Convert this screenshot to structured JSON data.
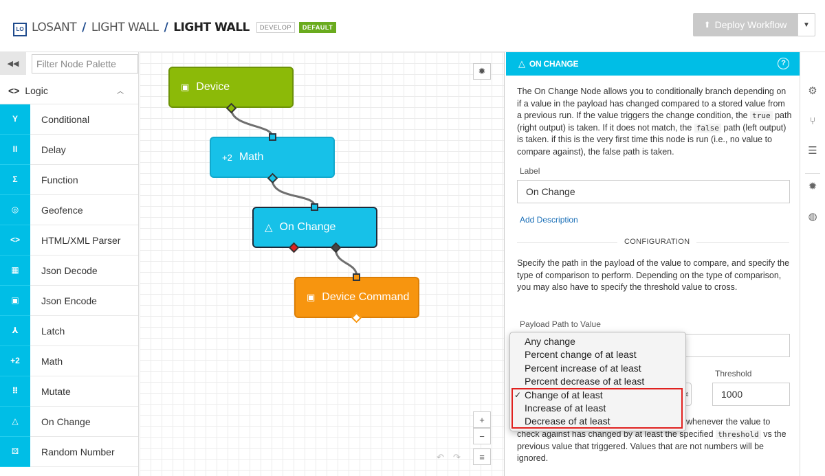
{
  "header": {
    "logo_text": "LO",
    "crumbs": [
      "LOSANT",
      "LIGHT WALL",
      "LIGHT WALL"
    ],
    "separator": "/",
    "tag_develop": "DEVELOP",
    "tag_default": "DEFAULT",
    "deploy_label": "Deploy Workflow"
  },
  "palette": {
    "filter_placeholder": "Filter Node Palette",
    "category": "Logic",
    "items": [
      {
        "icon": "Y",
        "label": "Conditional"
      },
      {
        "icon": "II",
        "label": "Delay"
      },
      {
        "icon": "Σ",
        "label": "Function"
      },
      {
        "icon": "◎",
        "label": "Geofence"
      },
      {
        "icon": "<>",
        "label": "HTML/XML Parser"
      },
      {
        "icon": "▦",
        "label": "Json Decode"
      },
      {
        "icon": "▣",
        "label": "Json Encode"
      },
      {
        "icon": "⅄",
        "label": "Latch"
      },
      {
        "icon": "+2",
        "label": "Math"
      },
      {
        "icon": "⠿",
        "label": "Mutate"
      },
      {
        "icon": "△",
        "label": "On Change"
      },
      {
        "icon": "⚄",
        "label": "Random Number"
      }
    ]
  },
  "canvas": {
    "nodes": {
      "device": {
        "icon": "▣",
        "label": "Device"
      },
      "math": {
        "icon": "+2",
        "label": "Math"
      },
      "onchange": {
        "icon": "△",
        "label": "On Change"
      },
      "devcmd": {
        "icon": "▣",
        "label": "Device Command"
      }
    },
    "zoom_in": "+",
    "zoom_out": "−",
    "menu": "≡"
  },
  "panel": {
    "title": "ON CHANGE",
    "help": "?",
    "desc_1": "The On Change Node allows you to conditionally branch depending on if a value in the payload has changed compared to a stored value from a previous run. If the value triggers the change condition, the",
    "code_true": "true",
    "desc_2": "path (right output) is taken. If it does not match, the",
    "code_false": "false",
    "desc_3": "path (left output) is taken. if this is the very first time this node is run (i.e., no value to compare against), the false path is taken.",
    "label_label": "Label",
    "label_value": "On Change",
    "add_description": "Add Description",
    "config_title": "CONFIGURATION",
    "config_desc": "Specify the path in the payload of the value to compare, and specify the type of comparison to perform. Depending on the type of comparison, you may also have to specify the threshold value to cross.",
    "payload_label": "Payload Path to Value",
    "threshold_label": "Threshold",
    "threshold_value": "1000",
    "bottom_1": "whenever the value to",
    "bottom_2a": "check against has changed by at least the specified",
    "code_threshold": "threshold",
    "bottom_2b": "vs the",
    "bottom_3": "previous value that triggered. Values that are not numbers will be",
    "bottom_4": "ignored."
  },
  "dropdown": {
    "options": [
      "Any change",
      "Percent change of at least",
      "Percent increase of at least",
      "Percent decrease of at least",
      "Change of at least",
      "Increase of at least",
      "Decrease of at least"
    ],
    "selected": "Change of at least",
    "check": "✓"
  },
  "colors": {
    "accent": "#00bee6",
    "device": "#8cba08",
    "command": "#f7950f",
    "highlight": "#e0211f"
  }
}
